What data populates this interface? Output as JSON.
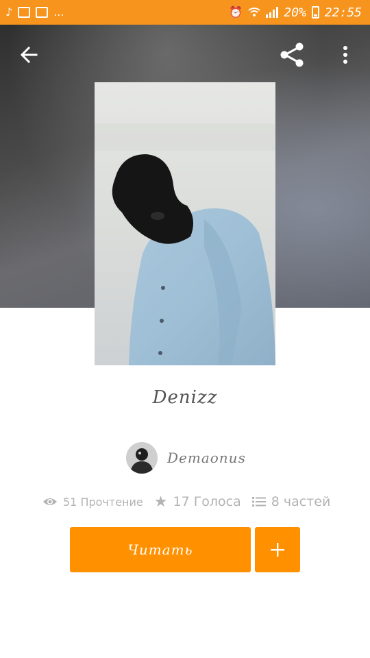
{
  "status_bar": {
    "battery_percent": "20%",
    "time": "22:55",
    "more_notifications": "..."
  },
  "toolbar": {
    "back_icon": "arrow-left-icon",
    "share_icon": "share-icon",
    "more_icon": "more-vertical-icon"
  },
  "story": {
    "title": "Denizz",
    "author": "Demaonus",
    "stats": {
      "reads": "51 Прочтение",
      "votes": "17 Голоса",
      "parts": "8 частей"
    }
  },
  "actions": {
    "read_label": "Читать",
    "add_label": "+"
  },
  "colors": {
    "accent": "#ff9000",
    "status_bar": "#f7941e",
    "muted_text": "#b3b3b3"
  }
}
